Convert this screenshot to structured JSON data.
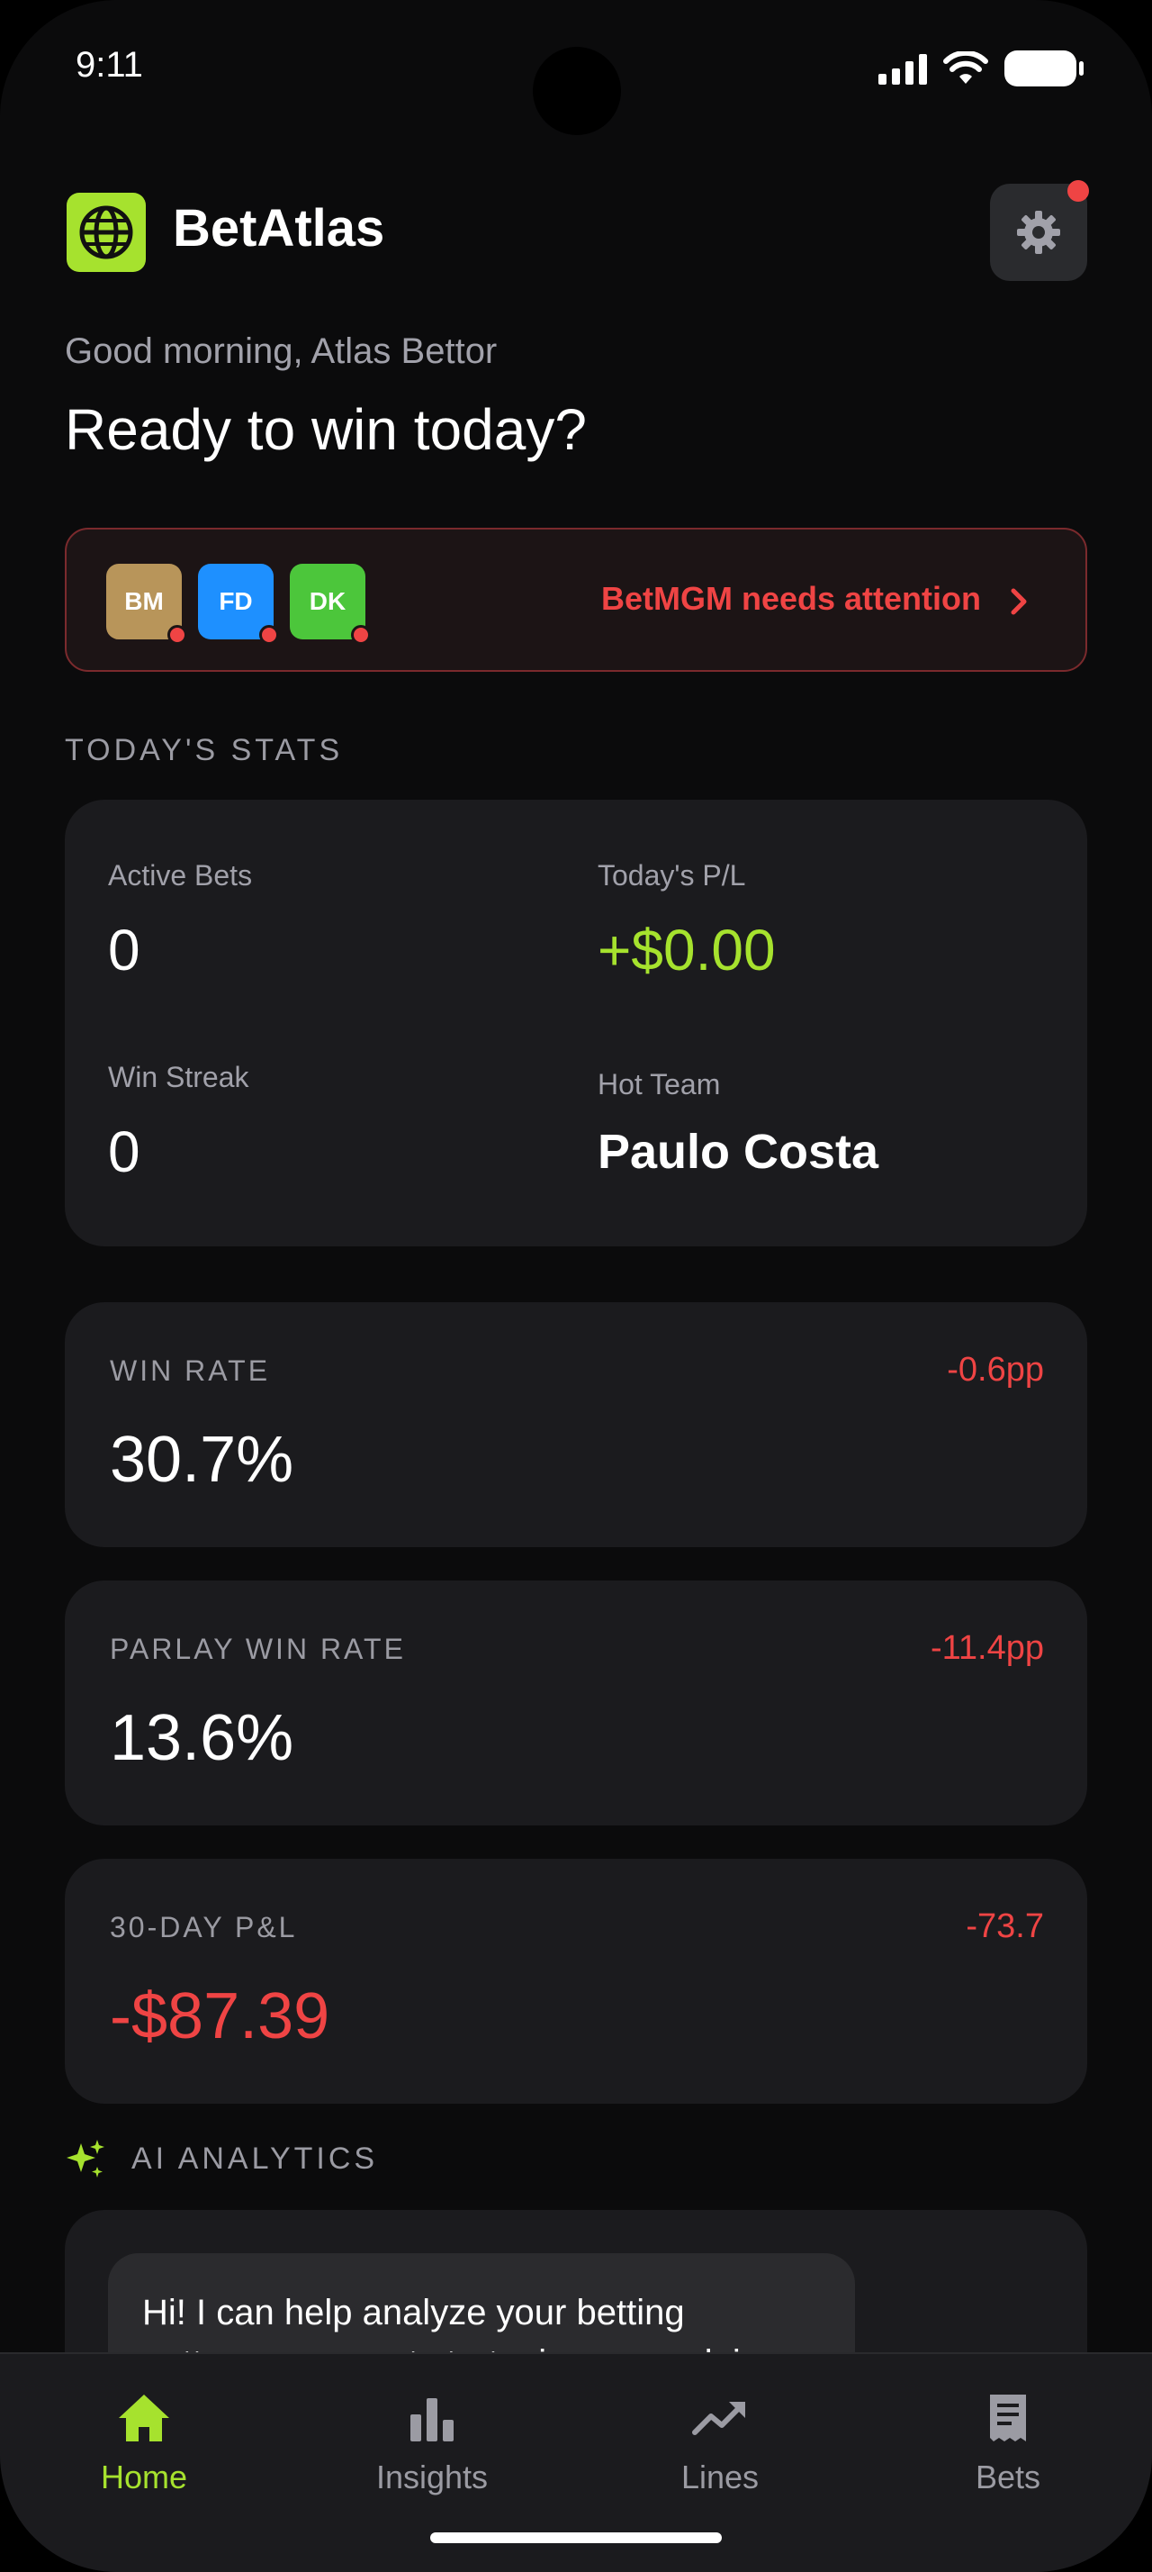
{
  "status_bar": {
    "time": "9:11"
  },
  "header": {
    "app_name": "BetAtlas"
  },
  "greeting": "Good morning, Atlas Bettor",
  "headline": "Ready to win today?",
  "attention_banner": {
    "sportsbooks": [
      {
        "abbr": "BM",
        "color": "#b8955a"
      },
      {
        "abbr": "FD",
        "color": "#1e90ff"
      },
      {
        "abbr": "DK",
        "color": "#4cc63b"
      }
    ],
    "message": "BetMGM needs attention"
  },
  "todays_stats": {
    "section_title": "TODAY'S STATS",
    "active_bets_label": "Active Bets",
    "active_bets_value": "0",
    "pl_label": "Today's P/L",
    "pl_value": "+$0.00",
    "win_streak_label": "Win Streak",
    "win_streak_value": "0",
    "hot_team_label": "Hot Team",
    "hot_team_value": "Paulo Costa"
  },
  "metrics": [
    {
      "label": "WIN RATE",
      "value": "30.7%",
      "delta": "-0.6pp"
    },
    {
      "label": "PARLAY WIN RATE",
      "value": "13.6%",
      "delta": "-11.4pp"
    },
    {
      "label": "30-DAY P&L",
      "value": "-$87.39",
      "delta": "-73.7"
    }
  ],
  "ai_analytics": {
    "section_title": "AI ANALYTICS",
    "message": "Hi! I can help analyze your betting patterns, suggest strategies, or explain"
  },
  "nav": [
    {
      "label": "Home",
      "icon": "home-icon",
      "active": true
    },
    {
      "label": "Insights",
      "icon": "bar-chart-icon",
      "active": false
    },
    {
      "label": "Lines",
      "icon": "trending-up-icon",
      "active": false
    },
    {
      "label": "Bets",
      "icon": "receipt-icon",
      "active": false
    }
  ],
  "colors": {
    "accent": "#a6e22e",
    "negative": "#ef4444",
    "positive": "#a6e22e",
    "card": "#1b1b1e",
    "background": "#0b0b0c"
  }
}
